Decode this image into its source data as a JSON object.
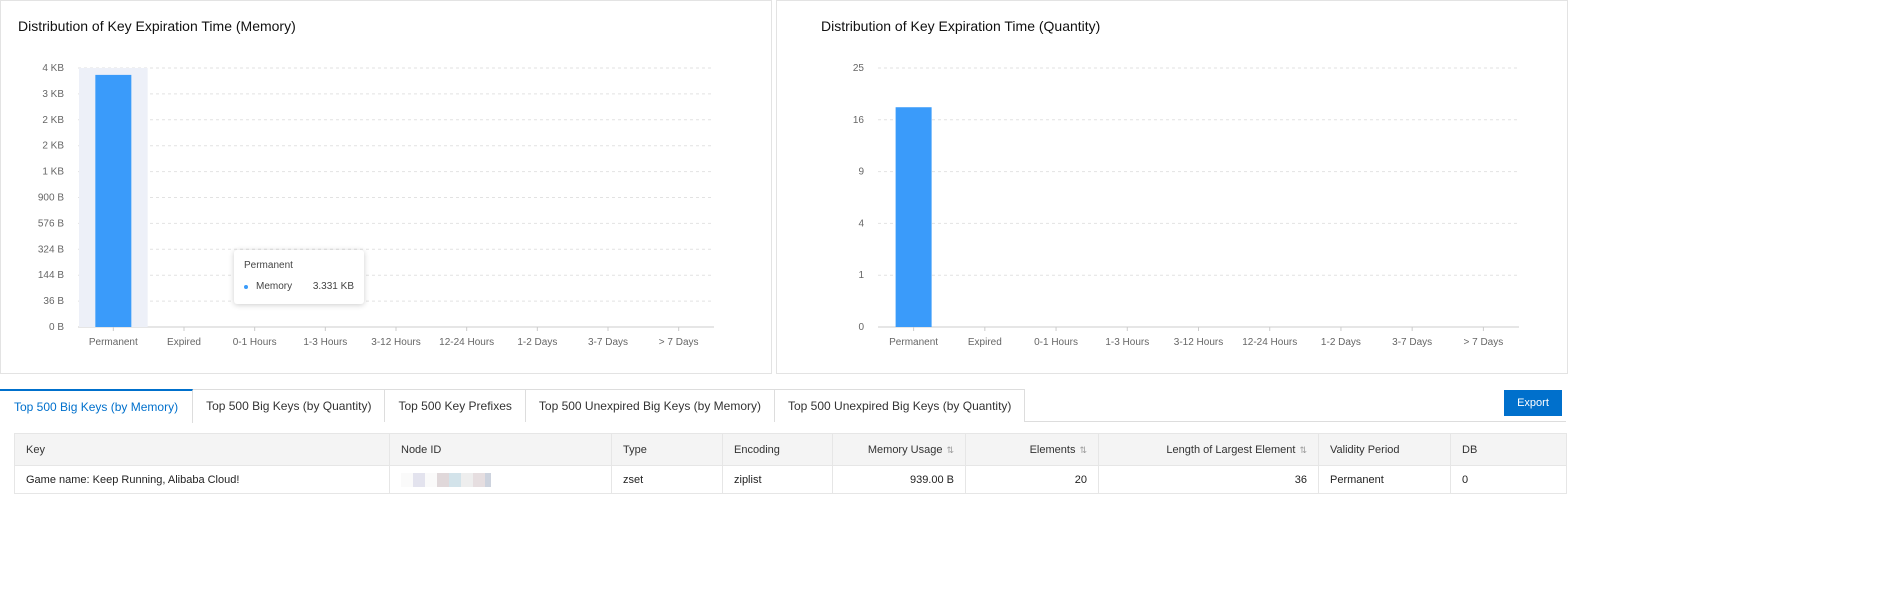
{
  "charts_header": {
    "memory_title": "Distribution of Key Expiration Time (Memory)",
    "quantity_title": "Distribution of Key Expiration Time (Quantity)"
  },
  "tooltip": {
    "category": "Permanent",
    "series": "Memory",
    "value": "3.331 KB"
  },
  "chart_data": [
    {
      "type": "bar",
      "title": "Distribution of Key Expiration Time (Memory)",
      "categories": [
        "Permanent",
        "Expired",
        "0-1 Hours",
        "1-3 Hours",
        "3-12 Hours",
        "12-24 Hours",
        "1-2 Days",
        "3-7 Days",
        "> 7 Days"
      ],
      "series": [
        {
          "name": "Memory",
          "values": [
            3411,
            0,
            0,
            0,
            0,
            0,
            0,
            0,
            0
          ]
        }
      ],
      "unit": "B",
      "yscale": "sqrt",
      "yticks": [
        0,
        36,
        144,
        324,
        576,
        900,
        1296,
        1764,
        2304,
        2916,
        3600
      ],
      "ytick_labels": [
        "0 B",
        "36 B",
        "144 B",
        "324 B",
        "576 B",
        "900 B",
        "1 KB",
        "2 KB",
        "2 KB",
        "3 KB",
        "4 KB"
      ],
      "ylim": [
        0,
        3600
      ],
      "grid": true,
      "highlight_color": "#3a9bfa"
    },
    {
      "type": "bar",
      "title": "Distribution of Key Expiration Time (Quantity)",
      "categories": [
        "Permanent",
        "Expired",
        "0-1 Hours",
        "1-3 Hours",
        "3-12 Hours",
        "12-24 Hours",
        "1-2 Days",
        "3-7 Days",
        "> 7 Days"
      ],
      "values": [
        18,
        0,
        0,
        0,
        0,
        0,
        0,
        0,
        0
      ],
      "yscale": "sqrt",
      "yticks": [
        0,
        1,
        4,
        9,
        16,
        25
      ],
      "ytick_labels": [
        "0",
        "1",
        "4",
        "9",
        "16",
        "25"
      ],
      "ylim": [
        0,
        25
      ],
      "grid": true,
      "color": "#3a9bfa"
    }
  ],
  "tabs": [
    {
      "label": "Top 500 Big Keys (by Memory)",
      "active": true
    },
    {
      "label": "Top 500 Big Keys (by Quantity)"
    },
    {
      "label": "Top 500 Key Prefixes"
    },
    {
      "label": "Top 500 Unexpired Big Keys (by Memory)"
    },
    {
      "label": "Top 500 Unexpired Big Keys (by Quantity)"
    }
  ],
  "export_label": "Export",
  "table": {
    "columns": [
      "Key",
      "Node ID",
      "Type",
      "Encoding",
      "Memory Usage",
      "Elements",
      "Length of Largest Element",
      "Validity Period",
      "DB"
    ],
    "rows": [
      {
        "key": "Game name: Keep Running, Alibaba Cloud!",
        "node_id": "",
        "type": "zset",
        "encoding": "ziplist",
        "memory": "939.00 B",
        "elements": "20",
        "largest": "36",
        "validity": "Permanent",
        "db": "0"
      }
    ]
  },
  "colors": {
    "accent": "#0070cc",
    "bar": "#3a9bfa"
  }
}
